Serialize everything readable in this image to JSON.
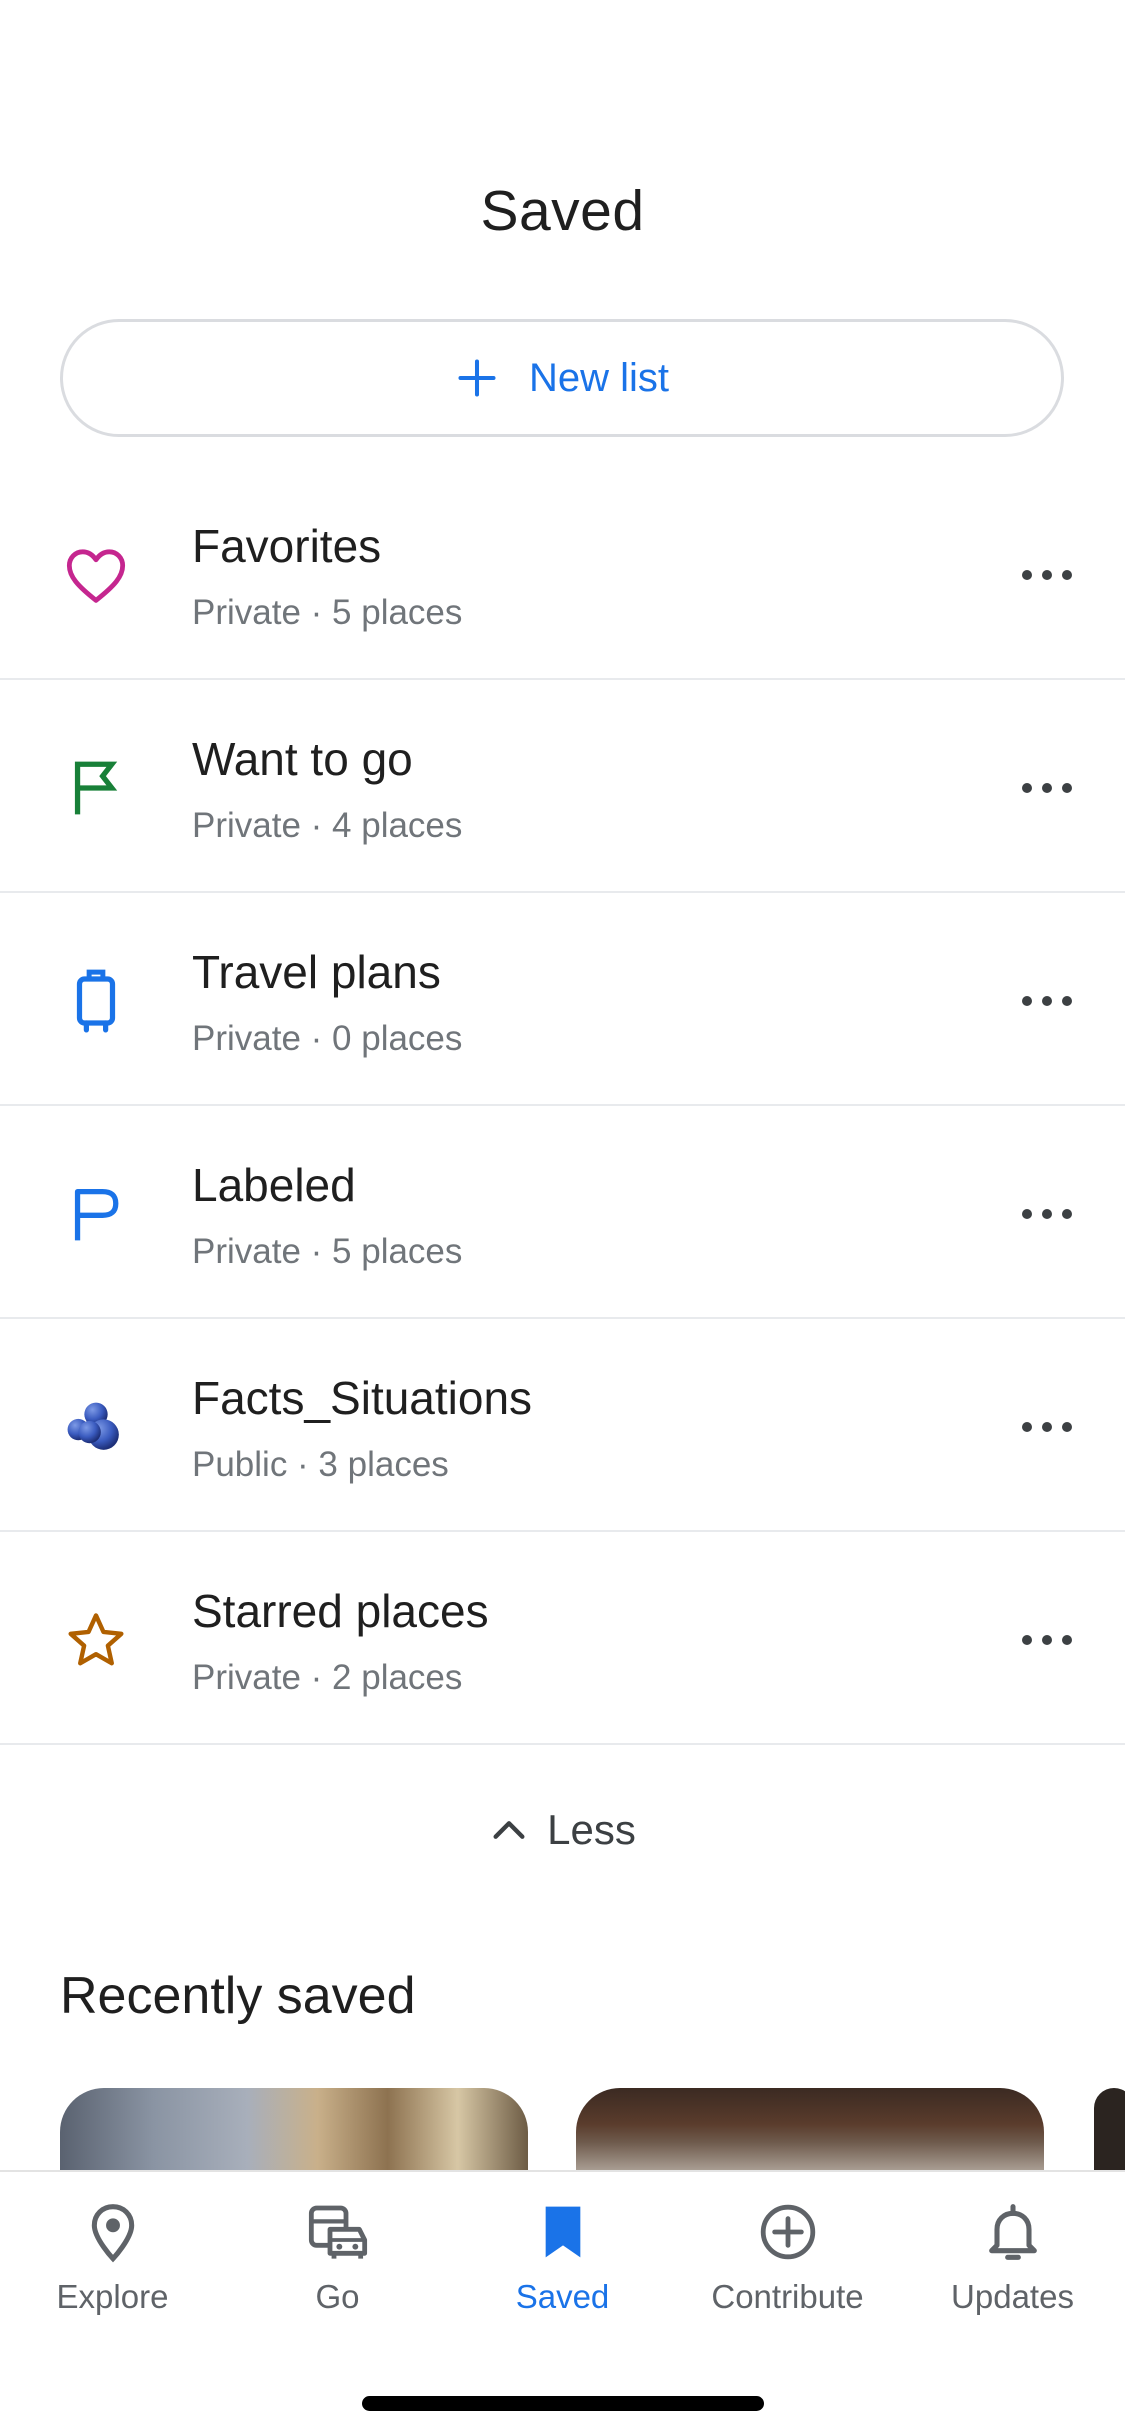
{
  "header": {
    "title": "Saved"
  },
  "new_list": {
    "label": "New list"
  },
  "lists": [
    {
      "name": "Favorites",
      "meta": "Private · 5 places",
      "icon": "heart-icon",
      "color": "#c5268f"
    },
    {
      "name": "Want to go",
      "meta": "Private · 4 places",
      "icon": "flag-icon",
      "color": "#188038"
    },
    {
      "name": "Travel plans",
      "meta": "Private · 0 places",
      "icon": "suitcase-icon",
      "color": "#1a73e8"
    },
    {
      "name": "Labeled",
      "meta": "Private · 5 places",
      "icon": "label-flag-icon",
      "color": "#1a73e8"
    },
    {
      "name": "Facts_Situations",
      "meta": "Public · 3 places",
      "icon": "blueberries-icon",
      "color": "#3557b7"
    },
    {
      "name": "Starred places",
      "meta": "Private · 2 places",
      "icon": "star-icon",
      "color": "#b06000"
    }
  ],
  "less": {
    "label": "Less"
  },
  "recently_saved": {
    "title": "Recently saved"
  },
  "tabs": [
    {
      "label": "Explore",
      "icon": "location-pin-icon",
      "active": false
    },
    {
      "label": "Go",
      "icon": "commute-icon",
      "active": false
    },
    {
      "label": "Saved",
      "icon": "bookmark-icon",
      "active": true
    },
    {
      "label": "Contribute",
      "icon": "add-circle-icon",
      "active": false
    },
    {
      "label": "Updates",
      "icon": "bell-icon",
      "active": false
    }
  ],
  "colors": {
    "accent": "#1a73e8",
    "text": "#1f1f1f",
    "secondary": "#70757a"
  }
}
